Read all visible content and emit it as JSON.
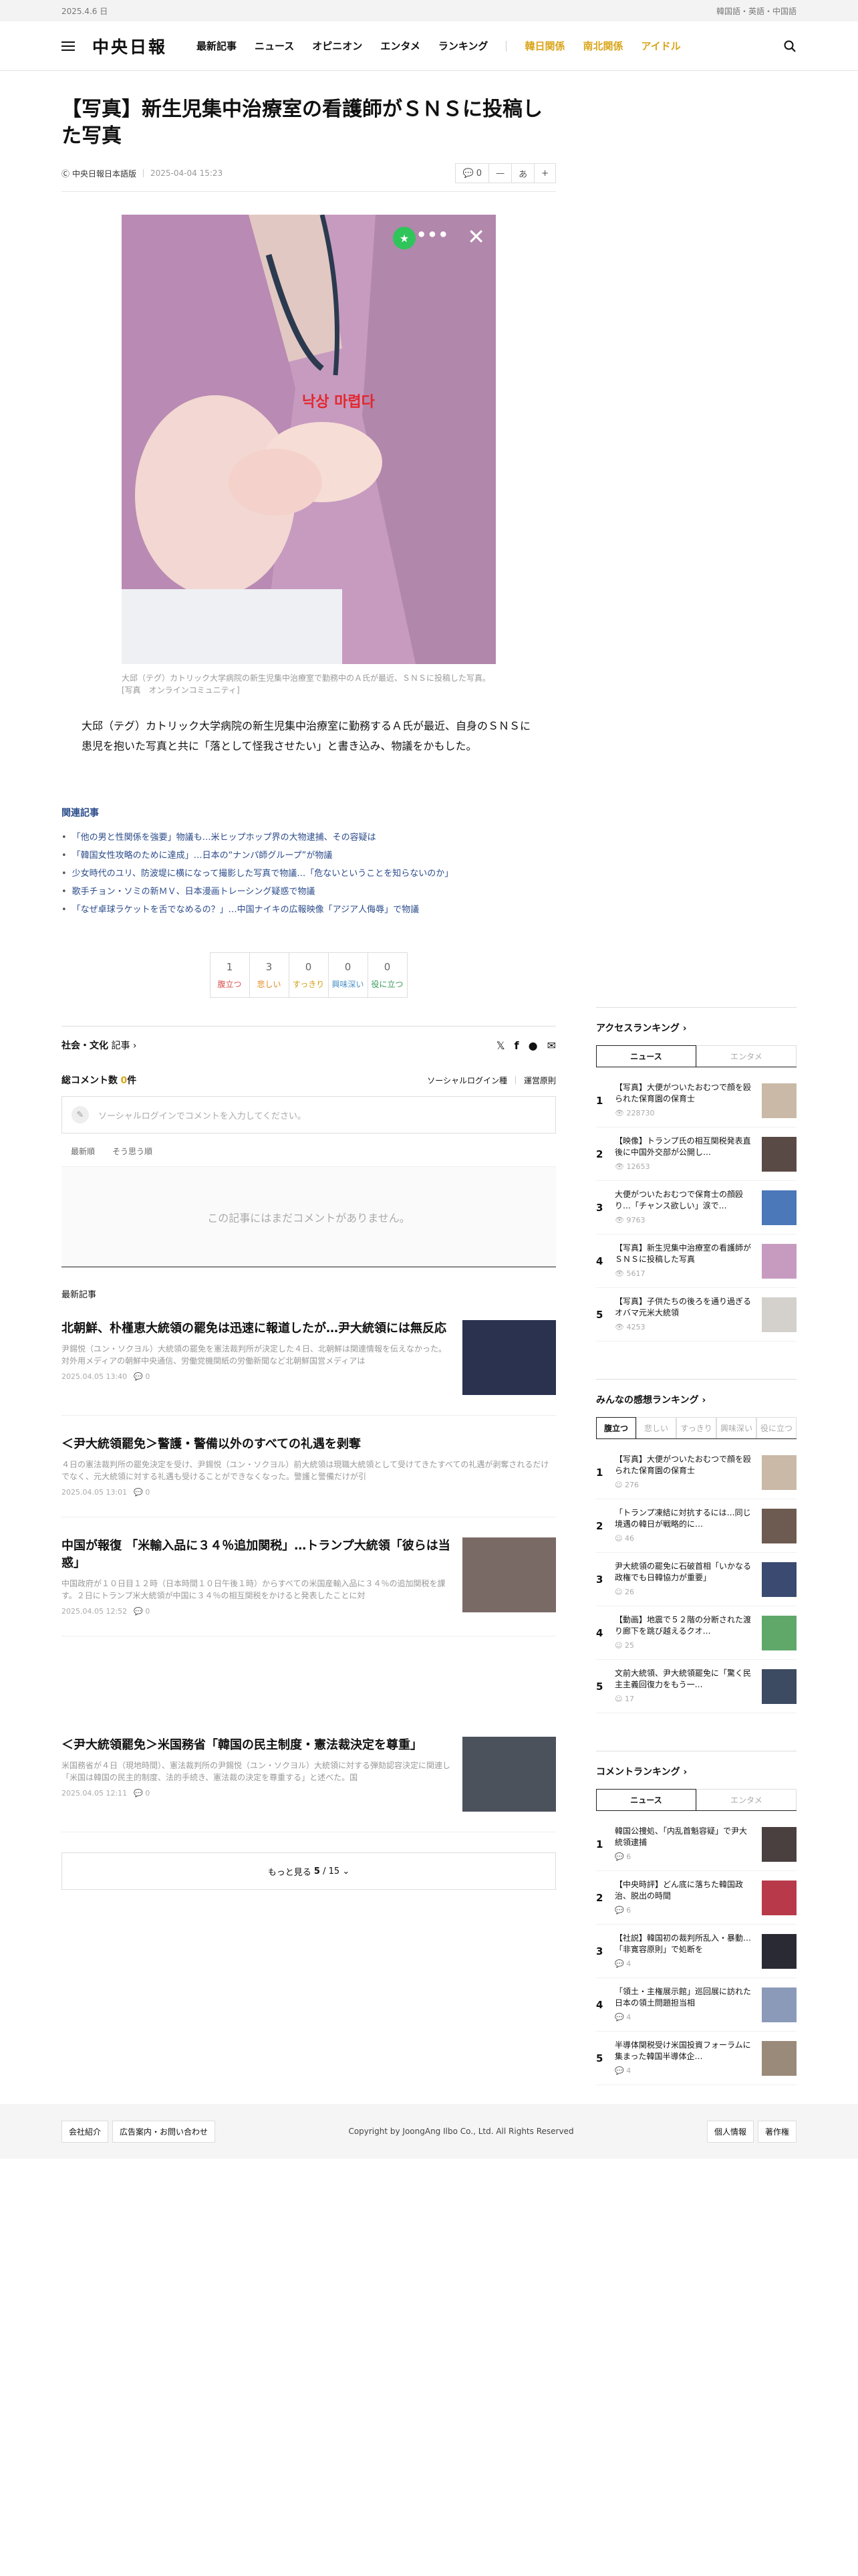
{
  "topbar": {
    "date": "2025.4.6 日",
    "languages": "韓国語・英語・中国語"
  },
  "header": {
    "logo": "中央日報",
    "nav": [
      "最新記事",
      "ニュース",
      "オピニオン",
      "エンタメ",
      "ランキング"
    ],
    "nav_highlight": [
      "韓日関係",
      "南北関係",
      "アイドル"
    ]
  },
  "article": {
    "title": "【写真】新生児集中治療室の看護師がＳＮＳに投稿した写真",
    "source": "中央日報日本語版",
    "date": "2025-04-04 15:23",
    "comment_count": "0",
    "font_label": "あ",
    "photo_overlay_text": "낙상 마렵다",
    "caption": "大邱（テグ）カトリック大学病院の新生児集中治療室で勤務中のＡ氏が最近、ＳＮＳに投稿した写真。[写真　オンラインコミュニティ]",
    "body": "大邱（テグ）カトリック大学病院の新生児集中治療室に勤務するＡ氏が最近、自身のＳＮＳに患児を抱いた写真と共に「落として怪我させたい」と書き込み、物議をかもした。"
  },
  "related": {
    "heading": "関連記事",
    "items": [
      "「他の男と性関係を強要」物議も…米ヒップホップ界の大物逮捕、その容疑は",
      "「韓国女性攻略のために達成」…日本の“ナンパ師グループ”が物議",
      "少女時代のユリ、防波堤に横になって撮影した写真で物議…「危ないということを知らないのか」",
      "歌手チョン・ソミの新ＭＶ、日本漫画トレーシング疑惑で物議",
      "「なぜ卓球ラケットを舌でなめるの？」…中国ナイキの広報映像「アジア人侮辱」で物議"
    ]
  },
  "reactions": [
    {
      "count": "1",
      "label": "腹立つ",
      "color": "#d9534f"
    },
    {
      "count": "3",
      "label": "悲しい",
      "color": "#e08a1e"
    },
    {
      "count": "0",
      "label": "すっきり",
      "color": "#d1a017"
    },
    {
      "count": "0",
      "label": "興味深い",
      "color": "#4a90c8"
    },
    {
      "count": "0",
      "label": "役に立つ",
      "color": "#3a9a5b"
    }
  ],
  "category": {
    "name": "社会・文化",
    "suffix": "記事"
  },
  "comments": {
    "title": "総コメント数",
    "count": "0",
    "unit": "件",
    "social_login": "ソーシャルログイン種",
    "policy": "運営原則",
    "placeholder": "ソーシャルログインでコメントを入力してください。",
    "sort": [
      "最新順",
      "そう思う順"
    ],
    "empty": "この記事にはまだコメントがありません。"
  },
  "latest": {
    "heading": "最新記事",
    "items": [
      {
        "title": "北朝鮮、朴槿恵大統領の罷免は迅速に報道したが…尹大統領には無反応",
        "desc": "尹錫悦（ユン・ソクヨル）大統領の罷免を憲法裁判所が決定した４日、北朝鮮は関連情報を伝えなかった。対外用メディアの朝鮮中央通信、労働党機関紙の労働新聞など北朝鮮国営メディアは",
        "date": "2025.04.05 13:40",
        "comments": "0"
      },
      {
        "title": "＜尹大統領罷免＞警護・警備以外のすべての礼遇を剥奪",
        "desc": "４日の憲法裁判所の罷免決定を受け、尹錫悦（ユン・ソクヨル）前大統領は現職大統領として受けてきたすべての礼遇が剥奪されるだけでなく、元大統領に対する礼遇も受けることができなくなった。警護と警備だけが引",
        "date": "2025.04.05 13:01",
        "comments": "0"
      },
      {
        "title": "中国が報復 「米輸入品に３４％追加関税」…トランプ大統領「彼らは当惑」",
        "desc": "中国政府が１０日目１２時（日本時間１０日午後１時）からすべての米国産輸入品に３４％の追加関税を課す。２日にトランプ米大統領が中国に３４％の相互関税をかけると発表したことに対",
        "date": "2025.04.05 12:52",
        "comments": "0"
      },
      {
        "title": "＜尹大統領罷免＞米国務省「韓国の民主制度・憲法裁決定を尊重」",
        "desc": "米国務省が４日（現地時間）、憲法裁判所の尹錫悦（ユン・ソクヨル）大統領に対する弾劾認容決定に関連し「米国は韓国の民主的制度、法的手続き、憲法裁の決定を尊重する」と述べた。国",
        "date": "2025.04.05 12:11",
        "comments": "0"
      }
    ],
    "more_label": "もっと見る",
    "page_current": "5",
    "page_total": "15"
  },
  "sidebar": {
    "access_ranking": {
      "title": "アクセスランキング",
      "tabs": [
        "ニュース",
        "エンタメ"
      ],
      "items": [
        {
          "rank": "1",
          "title": "【写真】大便がついたおむつで顔を殴られた保育園の保育士",
          "views": "228730"
        },
        {
          "rank": "2",
          "title": "【映像】トランプ氏の相互関税発表直後に中国外交部が公開し…",
          "views": "12653"
        },
        {
          "rank": "3",
          "title": "大便がついたおむつで保育士の顔殴り…「チャンス欲しい」涙で…",
          "views": "9763"
        },
        {
          "rank": "4",
          "title": "【写真】新生児集中治療室の看護師がＳＮＳに投稿した写真",
          "views": "5617"
        },
        {
          "rank": "5",
          "title": "【写真】子供たちの後ろを通り過ぎるオバマ元米大統領",
          "views": "4253"
        }
      ]
    },
    "reaction_ranking": {
      "title": "みんなの感想ランキング",
      "tabs": [
        "腹立つ",
        "悲しい",
        "すっきり",
        "興味深い",
        "役に立つ"
      ],
      "items": [
        {
          "rank": "1",
          "title": "【写真】大便がついたおむつで顔を殴られた保育園の保育士",
          "views": "276"
        },
        {
          "rank": "2",
          "title": "「トランプ凍結に対抗するには…同じ境遇の韓日が戦略的に…",
          "views": "46"
        },
        {
          "rank": "3",
          "title": "尹大統領の罷免に石破首相「いかなる政権でも日韓協力が重要」",
          "views": "26"
        },
        {
          "rank": "4",
          "title": "【動画】地震で５２階の分断された渡り廊下を跳び越えるクオ…",
          "views": "25"
        },
        {
          "rank": "5",
          "title": "文前大統領、尹大統領罷免に「驚く民主主義回復力をもう一…",
          "views": "17"
        }
      ]
    },
    "comment_ranking": {
      "title": "コメントランキング",
      "tabs": [
        "ニュース",
        "エンタメ"
      ],
      "items": [
        {
          "rank": "1",
          "title": "韓国公捜処、「内乱首魁容疑」で尹大統領逮捕",
          "views": "6"
        },
        {
          "rank": "2",
          "title": "【中央時評】どん底に落ちた韓国政治、脱出の時間",
          "views": "6"
        },
        {
          "rank": "3",
          "title": "【社説】韓国初の裁判所乱入・暴動…「非寛容原則」で処断を",
          "views": "4"
        },
        {
          "rank": "4",
          "title": "「領土・主権展示館」巡回展に訪れた日本の領土問題担当相",
          "views": "4"
        },
        {
          "rank": "5",
          "title": "半導体関税受け米国投資フォーラムに集まった韓国半導体企…",
          "views": "4"
        }
      ]
    }
  },
  "footer": {
    "left_links": [
      "会社紹介",
      "広告案内・お問い合わせ"
    ],
    "copyright": "Copyright by JoongAng Ilbo Co., Ltd. All Rights Reserved",
    "right_links": [
      "個人情報",
      "著作権"
    ]
  }
}
